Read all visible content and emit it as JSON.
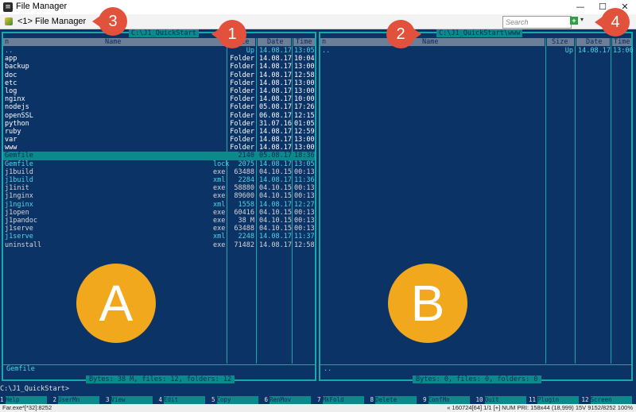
{
  "window": {
    "title": "File Manager"
  },
  "toolbar": {
    "tab_label": "<1> File Manager",
    "search_placeholder": "Search",
    "add_label": "+",
    "dropdown_label": "▾"
  },
  "left": {
    "path": "C:\\J1_QuickStart",
    "headers": {
      "name": "n",
      "name_full": "Name",
      "size": "Size",
      "date": "Date",
      "time": "Time"
    },
    "rows": [
      {
        "name": "..",
        "size": "Up",
        "date": "14.08.17",
        "time": "13:05"
      },
      {
        "name": "app",
        "size": "Folder",
        "date": "14.08.17",
        "time": "10:04"
      },
      {
        "name": "backup",
        "size": "Folder",
        "date": "14.08.17",
        "time": "13:00"
      },
      {
        "name": "doc",
        "size": "Folder",
        "date": "14.08.17",
        "time": "12:58"
      },
      {
        "name": "etc",
        "size": "Folder",
        "date": "14.08.17",
        "time": "13:00"
      },
      {
        "name": "log",
        "size": "Folder",
        "date": "14.08.17",
        "time": "13:00"
      },
      {
        "name": "nginx",
        "size": "Folder",
        "date": "14.08.17",
        "time": "10:00"
      },
      {
        "name": "nodejs",
        "size": "Folder",
        "date": "05.08.17",
        "time": "17:26"
      },
      {
        "name": "openSSL",
        "size": "Folder",
        "date": "06.08.17",
        "time": "12:15"
      },
      {
        "name": "python",
        "size": "Folder",
        "date": "31.07.16",
        "time": "01:05"
      },
      {
        "name": "ruby",
        "size": "Folder",
        "date": "14.08.17",
        "time": "12:59"
      },
      {
        "name": "var",
        "size": "Folder",
        "date": "14.08.17",
        "time": "13:00"
      },
      {
        "name": "www",
        "size": "Folder",
        "date": "14.08.17",
        "time": "13:00"
      },
      {
        "name": "Gemfile",
        "size": "2140",
        "date": "05.08.17",
        "time": "18:36"
      },
      {
        "name": "Gemfile",
        "ext": "lock",
        "size": "2075",
        "date": "14.08.17",
        "time": "13:05"
      },
      {
        "name": "j1build",
        "ext": "exe",
        "size": "63488",
        "date": "04.10.15",
        "time": "00:13"
      },
      {
        "name": "j1build",
        "ext": "xml",
        "size": "2284",
        "date": "14.08.17",
        "time": "11:36"
      },
      {
        "name": "j1init",
        "ext": "exe",
        "size": "58880",
        "date": "04.10.15",
        "time": "00:13"
      },
      {
        "name": "j1nginx",
        "ext": "exe",
        "size": "89600",
        "date": "04.10.15",
        "time": "00:13"
      },
      {
        "name": "j1nginx",
        "ext": "xml",
        "size": "1558",
        "date": "14.08.17",
        "time": "12:27"
      },
      {
        "name": "j1open",
        "ext": "exe",
        "size": "60416",
        "date": "04.10.15",
        "time": "00:13"
      },
      {
        "name": "j1pandoc",
        "ext": "exe",
        "size": "38 M",
        "date": "04.10.15",
        "time": "00:13"
      },
      {
        "name": "j1serve",
        "ext": "exe",
        "size": "63488",
        "date": "04.10.15",
        "time": "00:13"
      },
      {
        "name": "j1serve",
        "ext": "xml",
        "size": "2248",
        "date": "14.08.17",
        "time": "11:37"
      },
      {
        "name": "uninstall",
        "ext": "exe",
        "size": "71482",
        "date": "14.08.17",
        "time": "12:58"
      }
    ],
    "footer_name": "Gemfile",
    "stats": "Bytes: 38 M, files: 12, folders: 12"
  },
  "right": {
    "path": "C:\\J1_QuickStart\\www",
    "headers": {
      "name": "n",
      "name_full": "Name",
      "size": "Size",
      "date": "Date",
      "time": "Time"
    },
    "rows": [
      {
        "name": "..",
        "size": "Up",
        "date": "14.08.17",
        "time": "13:00"
      }
    ],
    "footer_name": "..",
    "stats": "Bytes: 0, files: 0, folders: 0"
  },
  "cmdline": "C:\\J1_QuickStart>",
  "keybar": [
    {
      "num": "1",
      "label": "Help"
    },
    {
      "num": "2",
      "label": "UserMn"
    },
    {
      "num": "3",
      "label": "View"
    },
    {
      "num": "4",
      "label": "Edit"
    },
    {
      "num": "5",
      "label": "Copy"
    },
    {
      "num": "6",
      "label": "RenMov"
    },
    {
      "num": "7",
      "label": "MkFold"
    },
    {
      "num": "8",
      "label": "Delete"
    },
    {
      "num": "9",
      "label": "ConfMn"
    },
    {
      "num": "10",
      "label": "Quit"
    },
    {
      "num": "11",
      "label": "Plugin"
    },
    {
      "num": "12",
      "label": "Screen"
    }
  ],
  "statusbar": {
    "left": "Far.exe*[*32]:8252",
    "right": "« 160724[64]   1/1   [+] NUM   PRI:   158x44   (18,999) 15V   9152/8252   100%"
  },
  "annotations": {
    "c1": "1",
    "c2": "2",
    "c3": "3",
    "c4": "4",
    "a": "A",
    "b": "B"
  },
  "colors": {
    "panel_bg": "#0c3366",
    "border": "#18a8a8",
    "selection": "#0a8a8a",
    "callout": "#e2513b",
    "big_marker": "#f2a81d"
  }
}
